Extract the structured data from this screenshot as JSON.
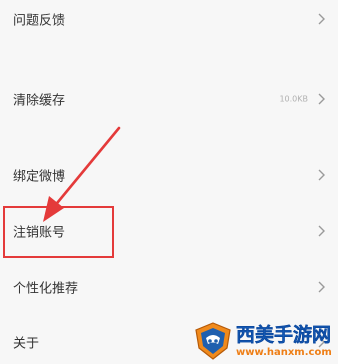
{
  "settings": {
    "items": [
      {
        "label": "问题反馈",
        "value": ""
      },
      {
        "label": "清除缓存",
        "value": "10.0KB"
      },
      {
        "label": "绑定微博",
        "value": ""
      },
      {
        "label": "注销账号",
        "value": ""
      },
      {
        "label": "个性化推荐",
        "value": ""
      },
      {
        "label": "关于",
        "value": ""
      }
    ]
  },
  "annotation": {
    "color": "#e43a3a"
  },
  "watermark": {
    "title": "西美手游网",
    "url": "www.hanxm.com"
  },
  "icons": {
    "chevron": "chevron-right-icon",
    "watermark_logo": "shield-logo-icon"
  }
}
